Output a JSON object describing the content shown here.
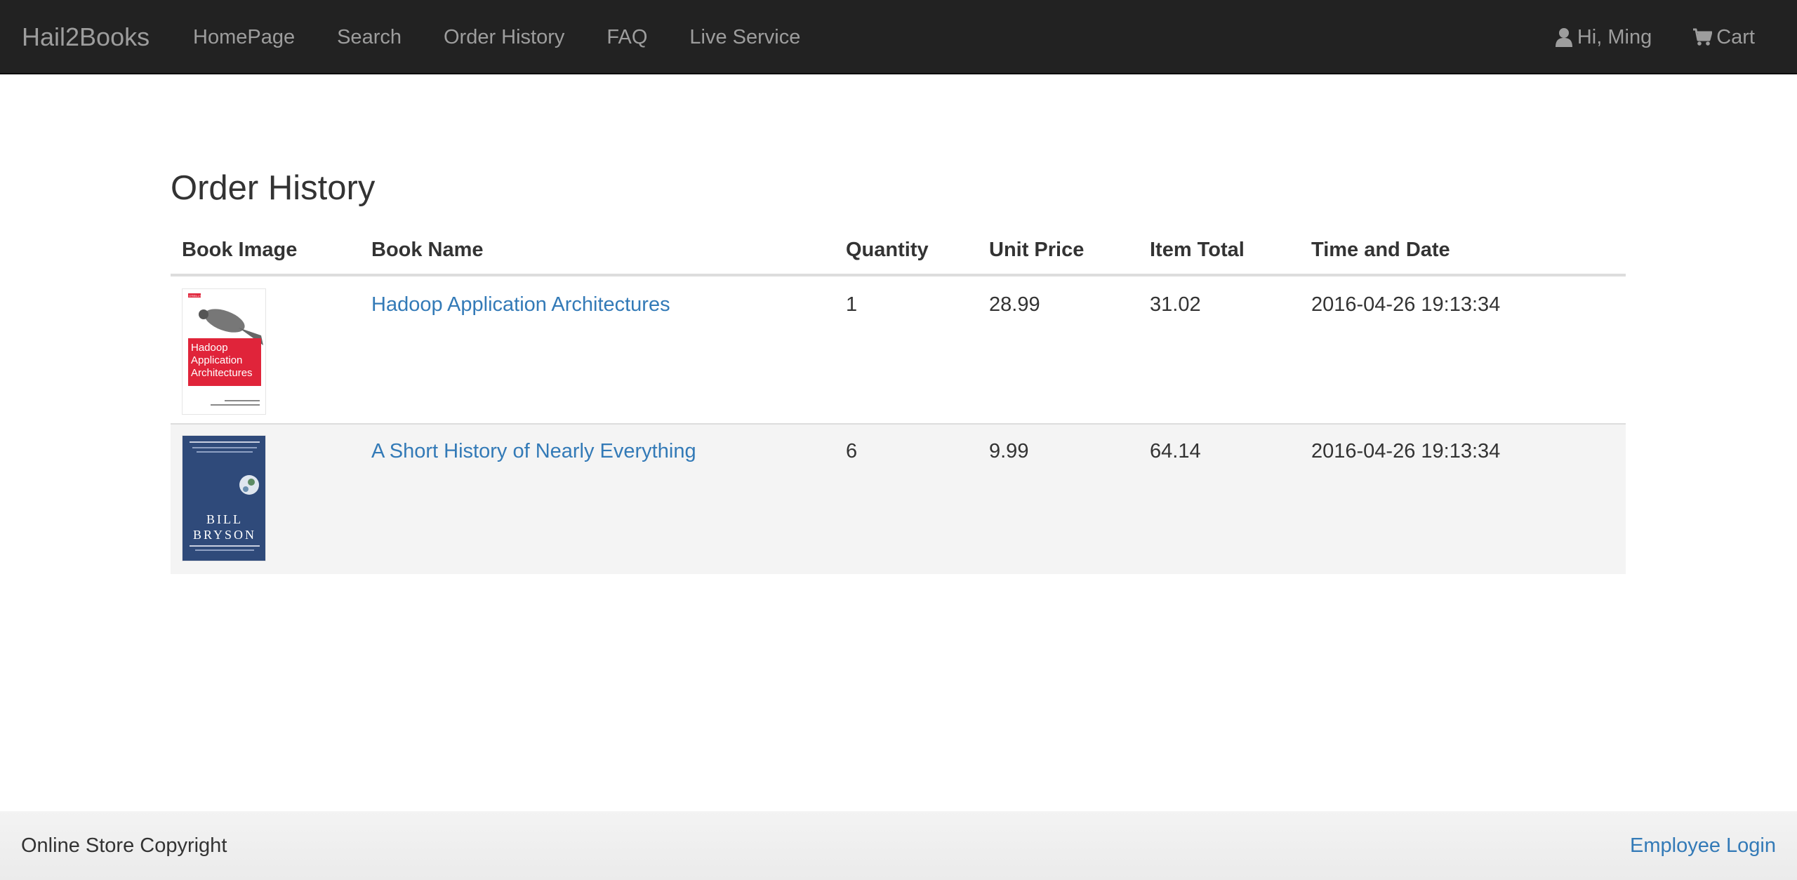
{
  "navbar": {
    "brand": "Hail2Books",
    "items": [
      {
        "label": "HomePage"
      },
      {
        "label": "Search"
      },
      {
        "label": "Order History"
      },
      {
        "label": "FAQ"
      },
      {
        "label": "Live Service"
      }
    ],
    "user": {
      "label": "Hi, Ming",
      "icon": "user-icon"
    },
    "cart": {
      "label": "Cart",
      "icon": "cart-icon"
    }
  },
  "main": {
    "title": "Order History",
    "columns": [
      "Book Image",
      "Book Name",
      "Quantity",
      "Unit Price",
      "Item Total",
      "Time and Date"
    ],
    "rows": [
      {
        "cover": {
          "title_lines": [
            "Hadoop",
            "Application",
            "Architectures"
          ],
          "brand": "O'REILLY",
          "accent": "#e0243a"
        },
        "name": "Hadoop Application Architectures",
        "quantity": "1",
        "unit_price": "28.99",
        "item_total": "31.02",
        "datetime": "2016-04-26 19:13:34"
      },
      {
        "cover": {
          "title_lines": [
            "BILL",
            "BRYSON"
          ],
          "accent": "#2f4a7a"
        },
        "name": "A Short History of Nearly Everything",
        "quantity": "6",
        "unit_price": "9.99",
        "item_total": "64.14",
        "datetime": "2016-04-26 19:13:34"
      }
    ]
  },
  "footer": {
    "left": "Online Store Copyright",
    "right": "Employee Login"
  },
  "colors": {
    "navbar_bg": "#222222",
    "nav_text": "#9d9d9d",
    "link": "#337ab7",
    "stripe": "#f4f4f4"
  }
}
